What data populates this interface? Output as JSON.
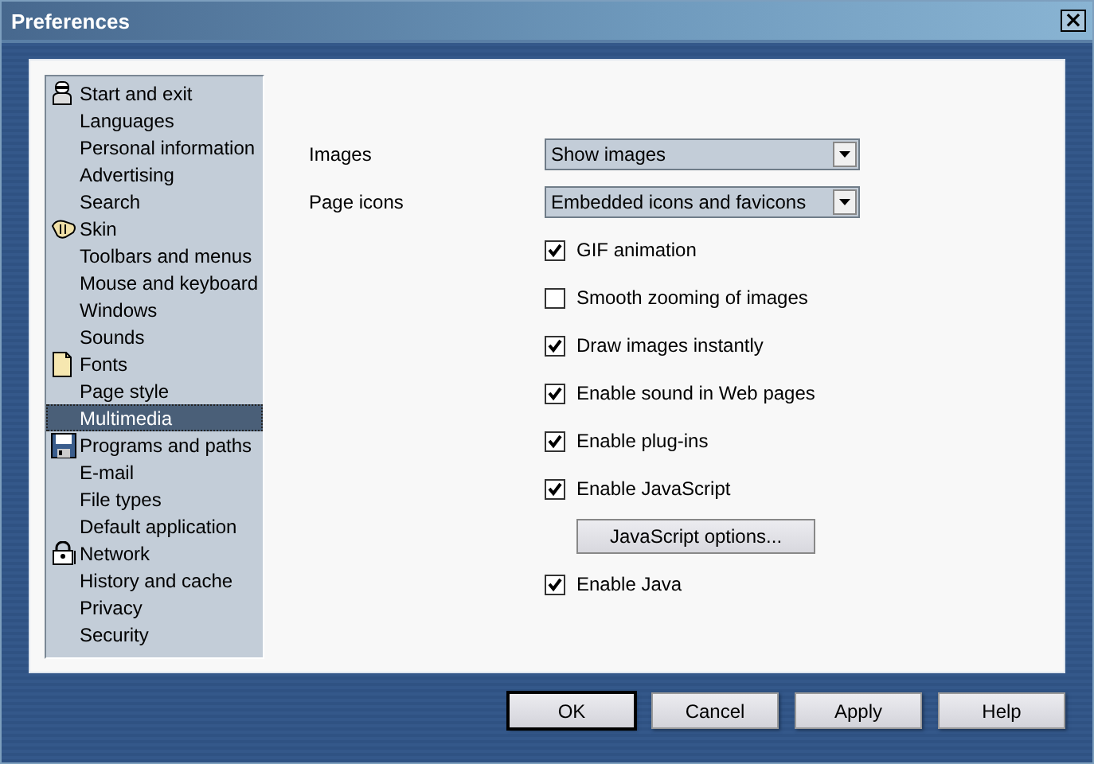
{
  "window": {
    "title": "Preferences",
    "close": "×"
  },
  "sidebar": {
    "items": [
      {
        "label": "Start and exit",
        "kind": "group",
        "selected": false
      },
      {
        "label": "Languages",
        "kind": "page",
        "selected": false
      },
      {
        "label": "Personal information",
        "kind": "page",
        "selected": false
      },
      {
        "label": "Advertising",
        "kind": "page",
        "selected": false
      },
      {
        "label": "Search",
        "kind": "page",
        "selected": false
      },
      {
        "label": "Skin",
        "kind": "group",
        "selected": false
      },
      {
        "label": "Toolbars and menus",
        "kind": "page",
        "selected": false
      },
      {
        "label": "Mouse and keyboard",
        "kind": "page",
        "selected": false
      },
      {
        "label": "Windows",
        "kind": "page",
        "selected": false
      },
      {
        "label": "Sounds",
        "kind": "page",
        "selected": false
      },
      {
        "label": "Fonts",
        "kind": "group",
        "selected": false
      },
      {
        "label": "Page style",
        "kind": "page",
        "selected": false
      },
      {
        "label": "Multimedia",
        "kind": "page",
        "selected": true
      },
      {
        "label": "Programs and paths",
        "kind": "group",
        "selected": false
      },
      {
        "label": "E-mail",
        "kind": "page",
        "selected": false
      },
      {
        "label": "File types",
        "kind": "page",
        "selected": false
      },
      {
        "label": "Default application",
        "kind": "page",
        "selected": false
      },
      {
        "label": "Network",
        "kind": "group",
        "selected": false
      },
      {
        "label": "History and cache",
        "kind": "page",
        "selected": false
      },
      {
        "label": "Privacy",
        "kind": "page",
        "selected": false
      },
      {
        "label": "Security",
        "kind": "page",
        "selected": false
      }
    ]
  },
  "settings": [
    {
      "kind": "select",
      "label": "Images",
      "value": "Show images"
    },
    {
      "kind": "select",
      "label": "Page icons",
      "value": "Embedded icons and favicons"
    },
    {
      "kind": "checkbox",
      "label": "GIF animation",
      "checked": true
    },
    {
      "kind": "checkbox",
      "label": "Smooth zooming of images",
      "checked": false
    },
    {
      "kind": "checkbox",
      "label": "Draw images instantly",
      "checked": true
    },
    {
      "kind": "checkbox",
      "label": "Enable sound in Web pages",
      "checked": true
    },
    {
      "kind": "checkbox",
      "label": "Enable plug-ins",
      "checked": true
    },
    {
      "kind": "checkbox",
      "label": "Enable JavaScript",
      "checked": true
    },
    {
      "kind": "button",
      "label": "JavaScript options..."
    },
    {
      "kind": "checkbox",
      "label": "Enable Java",
      "checked": true
    }
  ],
  "buttons": [
    {
      "label": "OK",
      "default": true
    },
    {
      "label": "Cancel",
      "default": false
    },
    {
      "label": "Apply",
      "default": false
    },
    {
      "label": "Help",
      "default": false
    }
  ]
}
